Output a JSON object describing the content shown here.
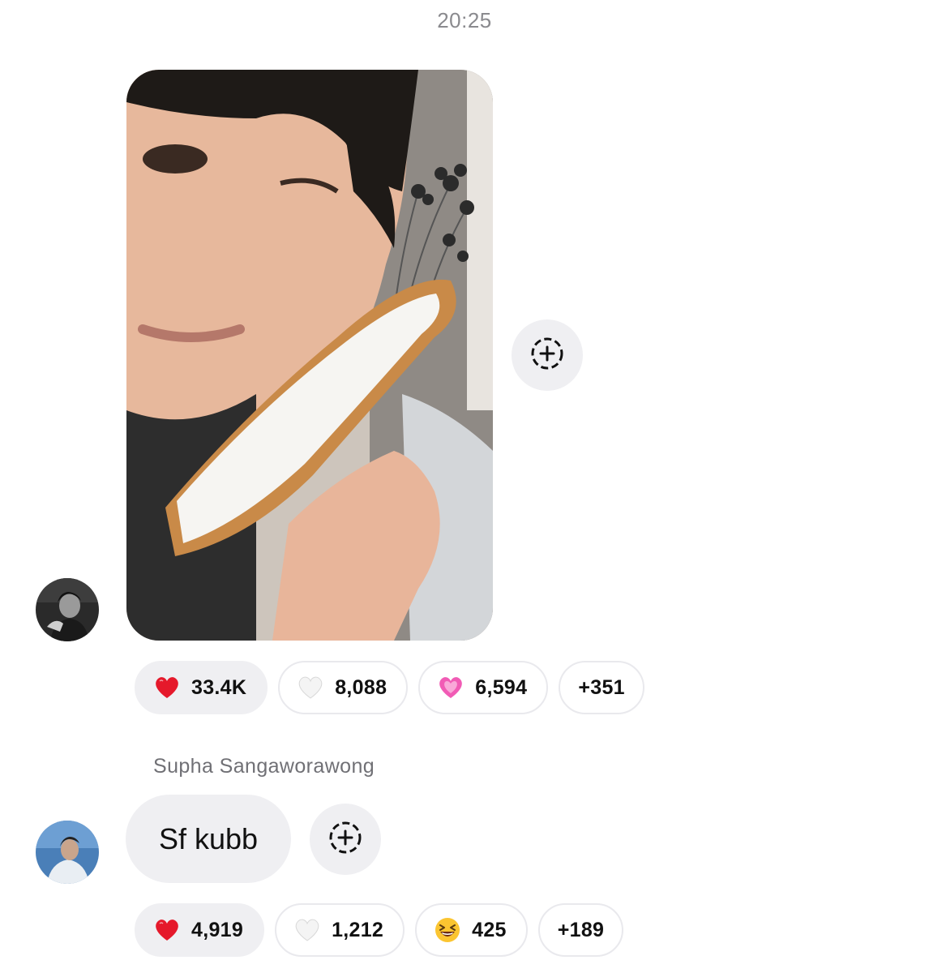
{
  "thread": {
    "timestamp": "20:25"
  },
  "message1": {
    "type": "photo",
    "reactions": [
      {
        "emoji": "red-heart",
        "count": "33.4K",
        "active": true
      },
      {
        "emoji": "white-heart",
        "count": "8,088",
        "active": false
      },
      {
        "emoji": "pink-heart",
        "count": "6,594",
        "active": false
      }
    ],
    "more_reactions": "+351"
  },
  "message2": {
    "sender": "Supha Sangaworawong",
    "text": "Sf kubb",
    "reactions": [
      {
        "emoji": "red-heart",
        "count": "4,919",
        "active": true
      },
      {
        "emoji": "white-heart",
        "count": "1,212",
        "active": false
      },
      {
        "emoji": "grinning-squinting-face",
        "count": "425",
        "active": false
      }
    ],
    "more_reactions": "+189"
  },
  "colors": {
    "pill_bg": "#efeff2",
    "pill_border": "#e9e9ed",
    "secondary_text": "#8a8a8e",
    "heart_red": "#e5192b",
    "heart_pink": "#f15bb5"
  }
}
